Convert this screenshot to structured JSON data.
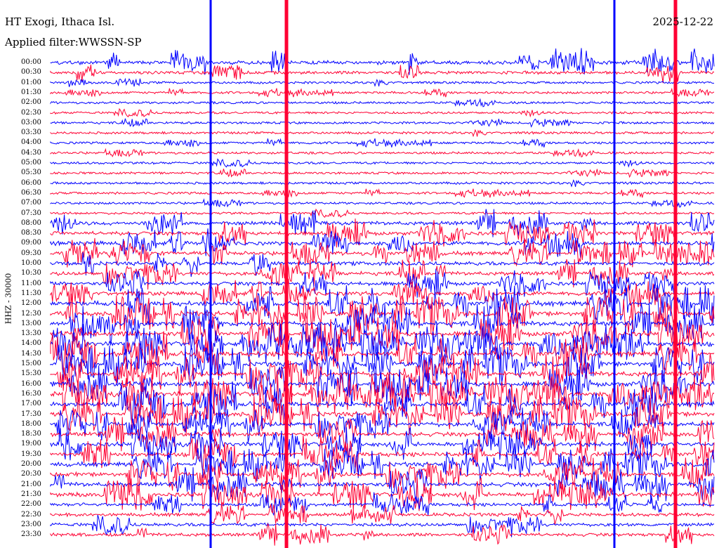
{
  "header": {
    "station": "HT Exogi, Ithaca Isl.",
    "filter": "Applied filter:WWSSN-SP",
    "date": "2025-12-22"
  },
  "channel_label": "HHZ - 30000",
  "time_labels": [
    "00:00",
    "00:30",
    "01:00",
    "01:30",
    "02:00",
    "02:30",
    "03:00",
    "03:30",
    "04:00",
    "04:30",
    "05:00",
    "05:30",
    "06:00",
    "06:30",
    "07:00",
    "07:30",
    "08:00",
    "08:30",
    "09:00",
    "09:30",
    "10:00",
    "10:30",
    "11:00",
    "11:30",
    "12:00",
    "12:30",
    "13:00",
    "13:30",
    "14:00",
    "14:30",
    "15:00",
    "15:30",
    "16:00",
    "16:30",
    "17:00",
    "17:30",
    "18:00",
    "18:30",
    "19:00",
    "19:30",
    "20:00",
    "20:30",
    "21:00",
    "21:30",
    "22:00",
    "22:30",
    "23:00",
    "23:30"
  ],
  "colors": {
    "trace_a": "#0000ff",
    "trace_b": "#ff0033",
    "background": "#ffffff",
    "text": "#000000"
  }
}
